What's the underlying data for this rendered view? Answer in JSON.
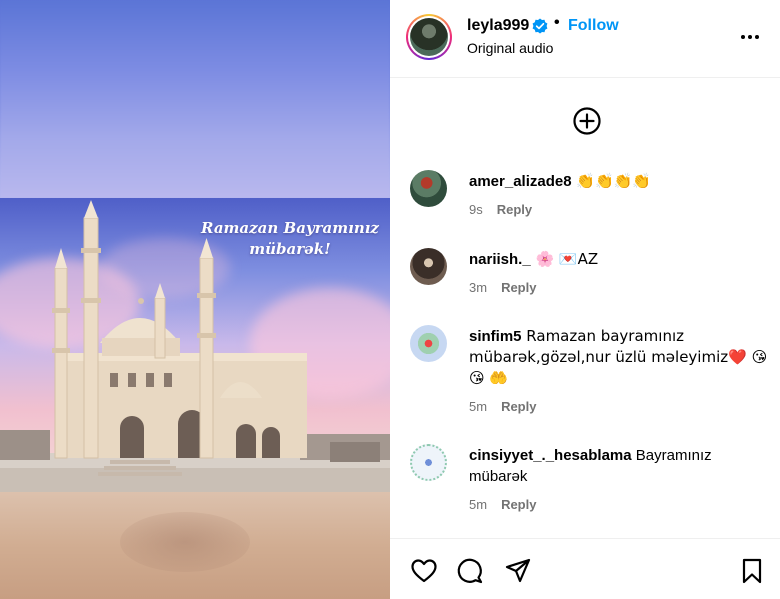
{
  "post": {
    "caption_line1": "Ramazan Bayramınız",
    "caption_line2": "mübarək!"
  },
  "header": {
    "username": "leyla999",
    "separator": "•",
    "follow_label": "Follow",
    "audio_label": "Original audio"
  },
  "comments": [
    {
      "username": "amer_alizade8",
      "text": " 👏👏👏👏",
      "time": "9s",
      "reply_label": "Reply"
    },
    {
      "username": "nariish._",
      "text": " 🌸 💌AZ",
      "time": "3m",
      "reply_label": "Reply"
    },
    {
      "username": "sinfim5",
      "text": " Ramazan bayramınız mübarək,gözəl,nur üzlü məleyimiz❤️ 😘 😘 🤲",
      "time": "5m",
      "reply_label": "Reply"
    },
    {
      "username": "cinsiyyet_._hesablama",
      "text": " Bayramınız mübarək",
      "time": "5m",
      "reply_label": "Reply"
    }
  ],
  "colors": {
    "accent": "#0095f6",
    "meta_text": "#737373",
    "divider": "#efefef"
  },
  "icons": {
    "header": [
      "verified-badge-icon",
      "more-options-icon"
    ],
    "comments": [
      "add-comment-icon"
    ],
    "footer": [
      "heart-icon",
      "comment-bubble-icon",
      "share-paper-plane-icon",
      "bookmark-icon"
    ]
  }
}
